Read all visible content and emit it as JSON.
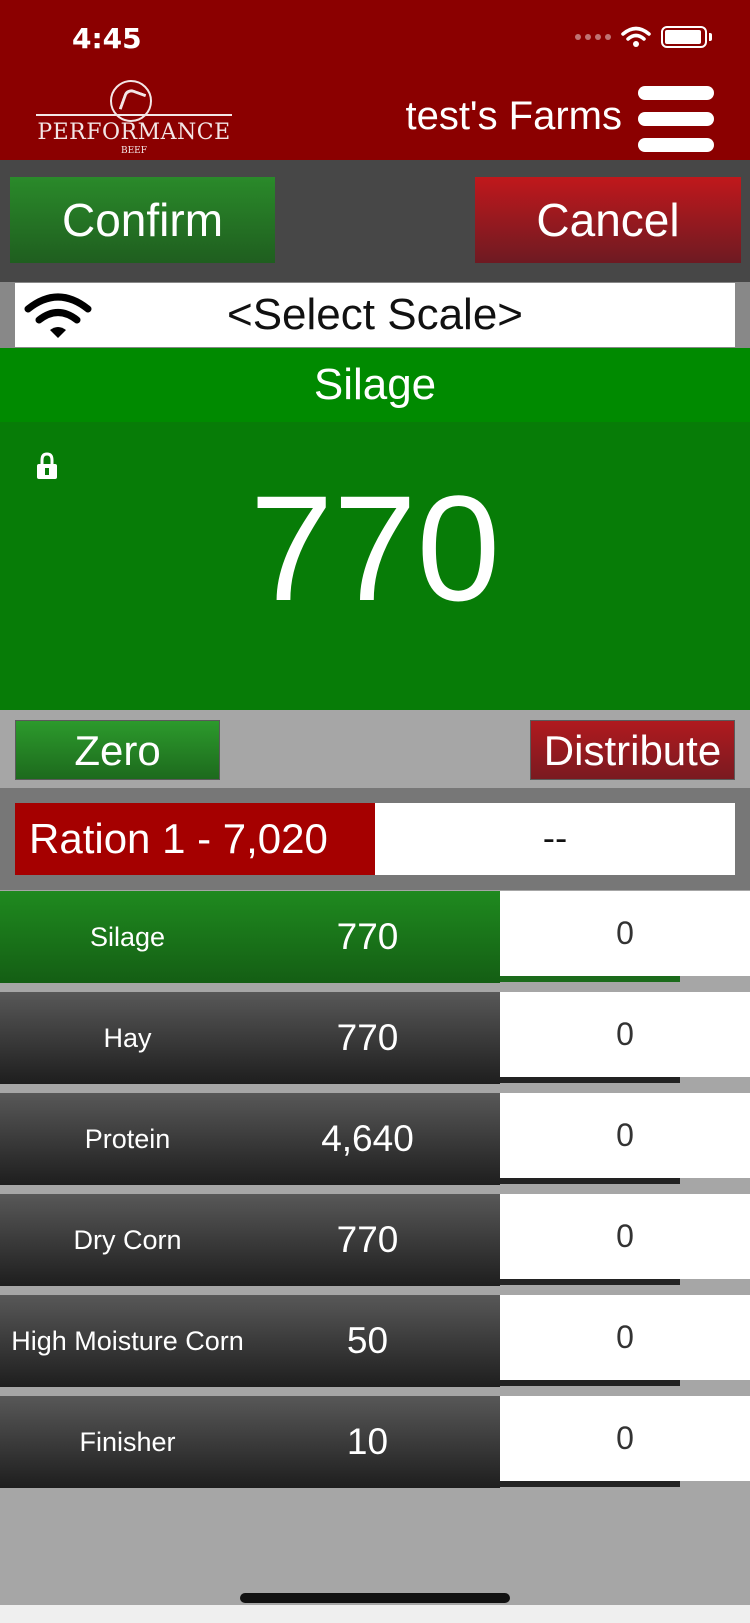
{
  "status": {
    "time": "4:45"
  },
  "header": {
    "logo_text": "PERFORMANCE",
    "logo_subtext": "BEEF",
    "farm_name": "test's Farms"
  },
  "actions": {
    "confirm_label": "Confirm",
    "cancel_label": "Cancel"
  },
  "scale": {
    "label": "<Select Scale>"
  },
  "current": {
    "ingredient": "Silage",
    "weight": "770"
  },
  "controls": {
    "zero_label": "Zero",
    "distribute_label": "Distribute"
  },
  "ration": {
    "label": "Ration 1 - 7,020",
    "value": "--"
  },
  "ingredients": [
    {
      "name": "Silage",
      "target": "770",
      "entered": "0",
      "active": true
    },
    {
      "name": "Hay",
      "target": "770",
      "entered": "0",
      "active": false
    },
    {
      "name": "Protein",
      "target": "4,640",
      "entered": "0",
      "active": false
    },
    {
      "name": "Dry Corn",
      "target": "770",
      "entered": "0",
      "active": false
    },
    {
      "name": "High Moisture Corn",
      "target": "50",
      "entered": "0",
      "active": false
    },
    {
      "name": "Finisher",
      "target": "10",
      "entered": "0",
      "active": false
    }
  ],
  "colors": {
    "header": "#8b0000",
    "active_green": "#008a00",
    "cancel_red": "#a50000"
  }
}
